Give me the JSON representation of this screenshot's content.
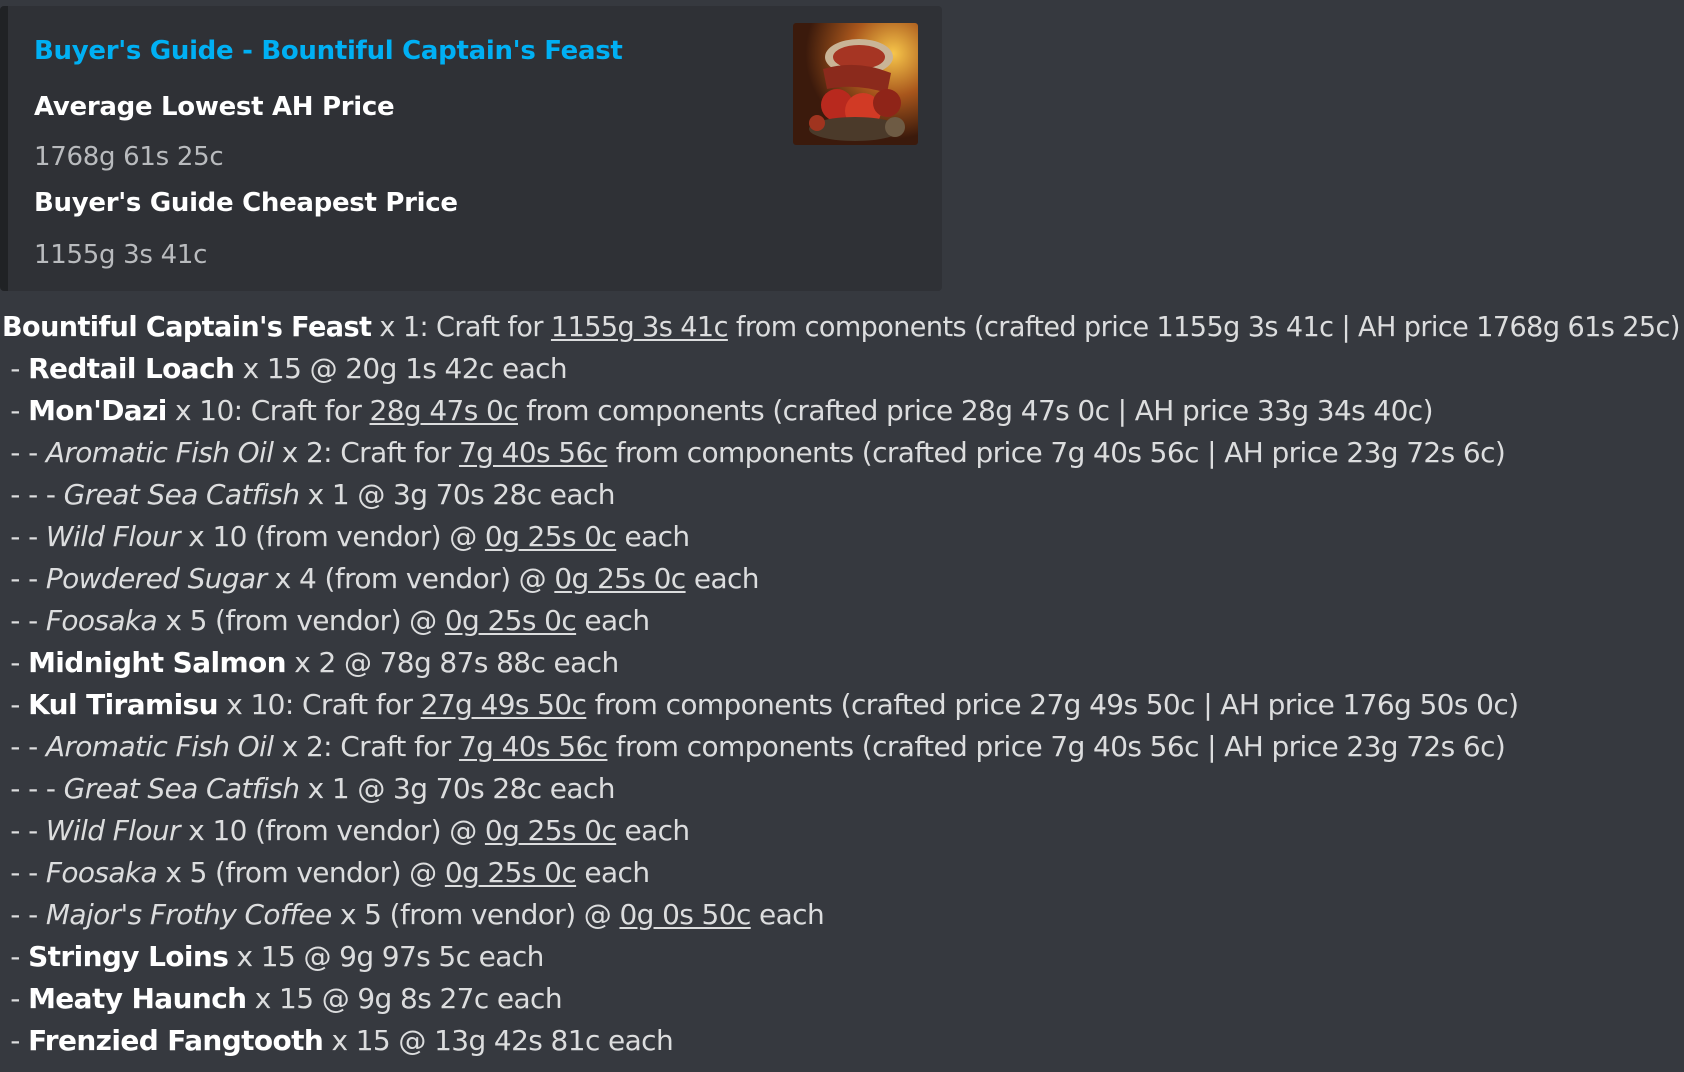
{
  "embed": {
    "title": "Buyer's Guide - Bountiful Captain's Feast",
    "fields": [
      {
        "name": "Average Lowest AH Price",
        "value": "1768g 61s 25c"
      },
      {
        "name": "Buyer's Guide Cheapest Price",
        "value": "1155g 3s 41c"
      }
    ],
    "thumbnail_icon": "feast-icon"
  },
  "lines": [
    {
      "prefix": "",
      "item": "Bountiful Captain's Feast",
      "style": "bold",
      "a": " x 1: Craft for ",
      "link": "1155g 3s 41c",
      "b": " from components (crafted price 1155g 3s 41c | AH price 1768g 61s 25c)"
    },
    {
      "prefix": " - ",
      "item": "Redtail Loach",
      "style": "bold",
      "a": " x 15 @ 20g 1s 42c each",
      "link": "",
      "b": ""
    },
    {
      "prefix": " - ",
      "item": "Mon'Dazi",
      "style": "bold",
      "a": " x 10: Craft for ",
      "link": "28g 47s 0c",
      "b": " from components (crafted price 28g 47s 0c | AH price 33g 34s 40c)"
    },
    {
      "prefix": " - - ",
      "item": "Aromatic Fish Oil",
      "style": "italic",
      "a": " x 2: Craft for ",
      "link": "7g 40s 56c",
      "b": " from components (crafted price 7g 40s 56c | AH price 23g 72s 6c)"
    },
    {
      "prefix": " - - - ",
      "item": "Great Sea Catfish",
      "style": "italic",
      "a": " x 1 @ 3g 70s 28c each",
      "link": "",
      "b": ""
    },
    {
      "prefix": " - - ",
      "item": "Wild Flour",
      "style": "italic",
      "a": " x 10 (from vendor) @ ",
      "link": "0g 25s 0c",
      "b": " each"
    },
    {
      "prefix": " - - ",
      "item": "Powdered Sugar",
      "style": "italic",
      "a": " x 4 (from vendor) @ ",
      "link": "0g 25s 0c",
      "b": " each"
    },
    {
      "prefix": " - - ",
      "item": "Foosaka",
      "style": "italic",
      "a": " x 5 (from vendor) @ ",
      "link": "0g 25s 0c",
      "b": " each"
    },
    {
      "prefix": " - ",
      "item": "Midnight Salmon",
      "style": "bold",
      "a": " x 2 @ 78g 87s 88c each",
      "link": "",
      "b": ""
    },
    {
      "prefix": " - ",
      "item": "Kul Tiramisu",
      "style": "bold",
      "a": " x 10: Craft for ",
      "link": "27g 49s 50c",
      "b": " from components (crafted price 27g 49s 50c | AH price 176g 50s 0c)"
    },
    {
      "prefix": " - - ",
      "item": "Aromatic Fish Oil",
      "style": "italic",
      "a": " x 2: Craft for ",
      "link": "7g 40s 56c",
      "b": " from components (crafted price 7g 40s 56c | AH price 23g 72s 6c)"
    },
    {
      "prefix": " - - - ",
      "item": "Great Sea Catfish",
      "style": "italic",
      "a": " x 1 @ 3g 70s 28c each",
      "link": "",
      "b": ""
    },
    {
      "prefix": " - - ",
      "item": "Wild Flour",
      "style": "italic",
      "a": " x 10 (from vendor) @ ",
      "link": "0g 25s 0c",
      "b": " each"
    },
    {
      "prefix": " - - ",
      "item": "Foosaka",
      "style": "italic",
      "a": " x 5 (from vendor) @ ",
      "link": "0g 25s 0c",
      "b": " each"
    },
    {
      "prefix": " - - ",
      "item": "Major's Frothy Coffee",
      "style": "italic",
      "a": " x 5 (from vendor) @ ",
      "link": "0g 0s 50c",
      "b": " each"
    },
    {
      "prefix": " - ",
      "item": "Stringy Loins",
      "style": "bold",
      "a": " x 15 @ 9g 97s 5c each",
      "link": "",
      "b": ""
    },
    {
      "prefix": " - ",
      "item": "Meaty Haunch",
      "style": "bold",
      "a": " x 15 @ 9g 8s 27c each",
      "link": "",
      "b": ""
    },
    {
      "prefix": " - ",
      "item": "Frenzied Fangtooth",
      "style": "bold",
      "a": " x 15 @ 13g 42s 81c each",
      "link": "",
      "b": ""
    }
  ]
}
